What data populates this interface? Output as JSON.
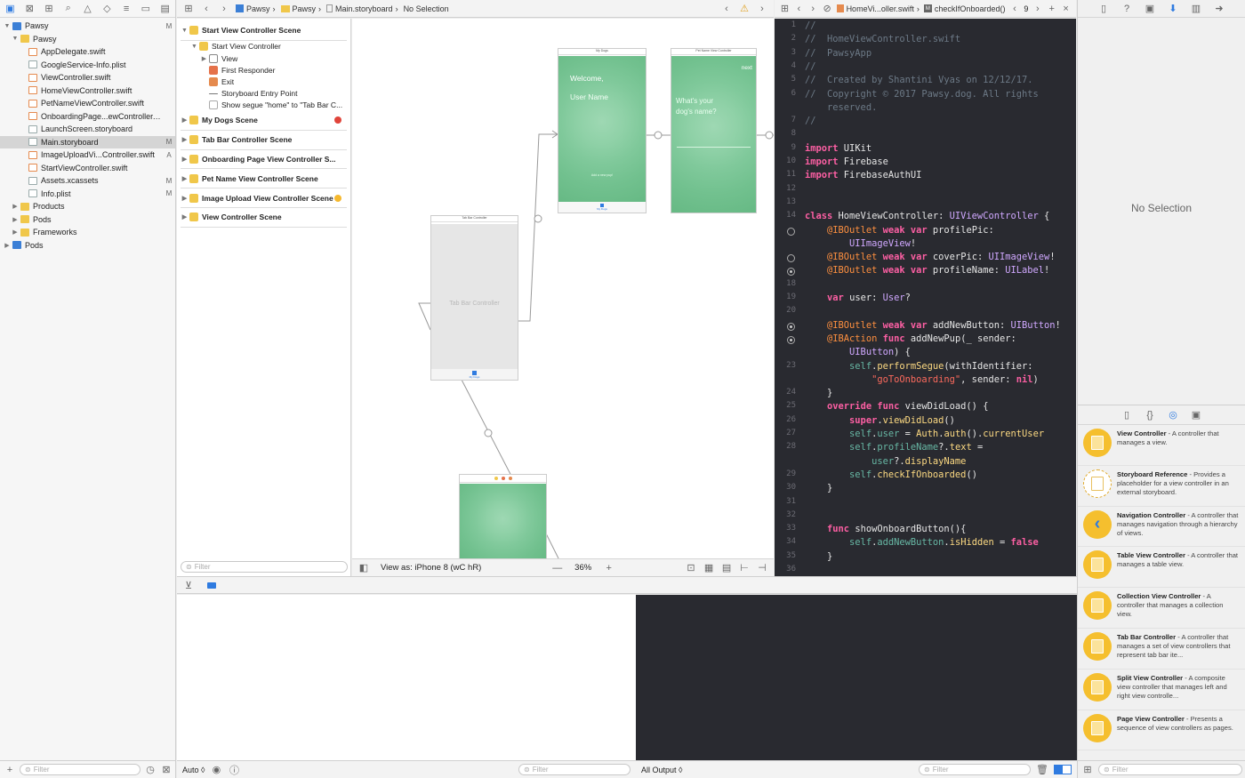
{
  "navigator": {
    "items": [
      {
        "label": "Pawsy",
        "badge": "M",
        "indent": 0,
        "disc": "▼",
        "icon": "f-proj"
      },
      {
        "label": "Pawsy",
        "badge": "",
        "indent": 1,
        "disc": "▼",
        "icon": "f-folder"
      },
      {
        "label": "AppDelegate.swift",
        "badge": "",
        "indent": 2,
        "disc": "",
        "icon": "f-swift"
      },
      {
        "label": "GoogleService-Info.plist",
        "badge": "",
        "indent": 2,
        "disc": "",
        "icon": "f-file"
      },
      {
        "label": "ViewController.swift",
        "badge": "",
        "indent": 2,
        "disc": "",
        "icon": "f-swift"
      },
      {
        "label": "HomeViewController.swift",
        "badge": "",
        "indent": 2,
        "disc": "",
        "icon": "f-swift"
      },
      {
        "label": "PetNameViewController.swift",
        "badge": "",
        "indent": 2,
        "disc": "",
        "icon": "f-swift"
      },
      {
        "label": "OnboardingPage...ewController.swift",
        "badge": "",
        "indent": 2,
        "disc": "",
        "icon": "f-swift"
      },
      {
        "label": "LaunchScreen.storyboard",
        "badge": "",
        "indent": 2,
        "disc": "",
        "icon": "f-file"
      },
      {
        "label": "Main.storyboard",
        "badge": "M",
        "indent": 2,
        "disc": "",
        "icon": "f-file",
        "selected": true
      },
      {
        "label": "ImageUploadVi...Controller.swift",
        "badge": "A",
        "indent": 2,
        "disc": "",
        "icon": "f-swift"
      },
      {
        "label": "StartViewController.swift",
        "badge": "",
        "indent": 2,
        "disc": "",
        "icon": "f-swift"
      },
      {
        "label": "Assets.xcassets",
        "badge": "M",
        "indent": 2,
        "disc": "",
        "icon": "f-file"
      },
      {
        "label": "Info.plist",
        "badge": "M",
        "indent": 2,
        "disc": "",
        "icon": "f-file"
      },
      {
        "label": "Products",
        "badge": "",
        "indent": 1,
        "disc": "▶",
        "icon": "f-folder"
      },
      {
        "label": "Pods",
        "badge": "",
        "indent": 1,
        "disc": "▶",
        "icon": "f-folder"
      },
      {
        "label": "Frameworks",
        "badge": "",
        "indent": 1,
        "disc": "▶",
        "icon": "f-folder"
      },
      {
        "label": "Pods",
        "badge": "",
        "indent": 0,
        "disc": "▶",
        "icon": "f-proj"
      }
    ],
    "filter_placeholder": "Filter"
  },
  "jumpbar": {
    "crumbs": [
      "Pawsy",
      "Pawsy",
      "Main.storyboard",
      "No Selection"
    ]
  },
  "outline": {
    "rows": [
      {
        "label": "Start View Controller Scene",
        "type": "scene",
        "indent": 0,
        "disc": "▼",
        "icon": "sico-scene"
      },
      {
        "label": "Start View Controller",
        "type": "item",
        "indent": 1,
        "disc": "▼",
        "icon": "sico-vc"
      },
      {
        "label": "View",
        "type": "item",
        "indent": 2,
        "disc": "▶",
        "icon": "sico-view"
      },
      {
        "label": "First Responder",
        "type": "item",
        "indent": 2,
        "disc": "",
        "icon": "sico-fr"
      },
      {
        "label": "Exit",
        "type": "item",
        "indent": 2,
        "disc": "",
        "icon": "sico-exit"
      },
      {
        "label": "Storyboard Entry Point",
        "type": "item",
        "indent": 2,
        "disc": "",
        "icon": "sico-arrow"
      },
      {
        "label": "Show segue \"home\" to \"Tab Bar C...",
        "type": "item",
        "indent": 2,
        "disc": "",
        "icon": "sico-segue"
      },
      {
        "label": "My Dogs Scene",
        "type": "scene",
        "indent": 0,
        "disc": "▶",
        "icon": "sico-scene",
        "status": "#e0443a"
      },
      {
        "label": "Tab Bar Controller Scene",
        "type": "scene",
        "indent": 0,
        "disc": "▶",
        "icon": "sico-scene"
      },
      {
        "label": "Onboarding Page View Controller S...",
        "type": "scene",
        "indent": 0,
        "disc": "▶",
        "icon": "sico-scene"
      },
      {
        "label": "Pet Name View Controller Scene",
        "type": "scene",
        "indent": 0,
        "disc": "▶",
        "icon": "sico-scene"
      },
      {
        "label": "Image Upload View Controller Scene",
        "type": "scene",
        "indent": 0,
        "disc": "▶",
        "icon": "sico-scene",
        "status": "#f5b82e"
      },
      {
        "label": "View Controller Scene",
        "type": "scene",
        "indent": 0,
        "disc": "▶",
        "icon": "sico-scene"
      }
    ],
    "filter_placeholder": "Filter"
  },
  "canvas": {
    "my_dogs": {
      "title": "My Dogs",
      "welcome": "Welcome,",
      "user": "User Name",
      "add": "Add a new pup!",
      "tab": "My Dogs"
    },
    "pet_name": {
      "title": "Pet Name View Controller",
      "next": "next",
      "question": "What's your dog's name?"
    },
    "tab_bar": {
      "title": "Tab Bar Controller",
      "label": "Tab Bar Controller",
      "tab": "My Dogs"
    },
    "footer": {
      "view_as": "View as: iPhone 8 (wC hR)",
      "zoom": "36%"
    }
  },
  "code_header": {
    "file": "HomeVi...oller.swift",
    "symbol": "checkIfOnboarded()",
    "count": "9"
  },
  "code": [
    {
      "n": "1",
      "h": "<span class=\"cm\">//</span>"
    },
    {
      "n": "2",
      "h": "<span class=\"cm\">//  HomeViewController.swift</span>"
    },
    {
      "n": "3",
      "h": "<span class=\"cm\">//  PawsyApp</span>"
    },
    {
      "n": "4",
      "h": "<span class=\"cm\">//</span>"
    },
    {
      "n": "5",
      "h": "<span class=\"cm\">//  Created by Shantini Vyas on 12/12/17.</span>"
    },
    {
      "n": "6",
      "h": "<span class=\"cm\">//  Copyright © 2017 Pawsy.dog. All rights</span>"
    },
    {
      "n": "",
      "h": "<span class=\"cm\">    reserved.</span>"
    },
    {
      "n": "7",
      "h": "<span class=\"cm\">//</span>"
    },
    {
      "n": "8",
      "h": ""
    },
    {
      "n": "9",
      "h": "<span class=\"kw\">import</span> UIKit"
    },
    {
      "n": "10",
      "h": "<span class=\"kw\">import</span> Firebase"
    },
    {
      "n": "11",
      "h": "<span class=\"kw\">import</span> FirebaseAuthUI"
    },
    {
      "n": "12",
      "h": ""
    },
    {
      "n": "13",
      "h": ""
    },
    {
      "n": "14",
      "h": "<span class=\"kw\">class</span> HomeViewController: <span class=\"ty\">UIViewController</span> {"
    },
    {
      "n": "",
      "g": "o",
      "h": "    <span class=\"at\">@IBOutlet</span> <span class=\"kw\">weak var</span> profilePic:"
    },
    {
      "n": "",
      "h": "        <span class=\"ty\">UIImageView</span>!"
    },
    {
      "n": "",
      "g": "o",
      "h": "    <span class=\"at\">@IBOutlet</span> <span class=\"kw\">weak var</span> coverPic: <span class=\"ty\">UIImageView</span>!"
    },
    {
      "n": "",
      "g": "f",
      "h": "    <span class=\"at\">@IBOutlet</span> <span class=\"kw\">weak var</span> profileName: <span class=\"ty\">UILabel</span>!"
    },
    {
      "n": "18",
      "h": ""
    },
    {
      "n": "19",
      "h": "    <span class=\"kw\">var</span> user: <span class=\"ty\">User</span>?"
    },
    {
      "n": "20",
      "h": ""
    },
    {
      "n": "",
      "g": "f",
      "h": "    <span class=\"at\">@IBOutlet</span> <span class=\"kw\">weak var</span> addNewButton: <span class=\"ty\">UIButton</span>!"
    },
    {
      "n": "",
      "g": "f",
      "h": "    <span class=\"at\">@IBAction</span> <span class=\"kw\">func</span> addNewPup(_ sender:"
    },
    {
      "n": "",
      "h": "        <span class=\"ty\">UIButton</span>) {"
    },
    {
      "n": "23",
      "h": "        <span class=\"fn\">self</span>.<span class=\"yl\">performSegue</span>(withIdentifier:"
    },
    {
      "n": "",
      "h": "            <span class=\"st\">\"goToOnboarding\"</span>, sender: <span class=\"nil\">nil</span>)"
    },
    {
      "n": "24",
      "h": "    }"
    },
    {
      "n": "25",
      "h": "    <span class=\"kw\">override func</span> viewDidLoad() {"
    },
    {
      "n": "26",
      "h": "        <span class=\"kw\">super</span>.<span class=\"yl\">viewDidLoad</span>()"
    },
    {
      "n": "27",
      "h": "        <span class=\"fn\">self</span>.<span class=\"fn\">user</span> = <span class=\"yl\">Auth</span>.<span class=\"yl\">auth</span>().<span class=\"yl\">currentUser</span>"
    },
    {
      "n": "28",
      "h": "        <span class=\"fn\">self</span>.<span class=\"fn\">profileName</span>?.<span class=\"yl\">text</span> ="
    },
    {
      "n": "",
      "h": "            <span class=\"fn\">user</span>?.<span class=\"yl\">displayName</span>"
    },
    {
      "n": "29",
      "h": "        <span class=\"fn\">self</span>.<span class=\"yl\">checkIfOnboarded</span>()"
    },
    {
      "n": "30",
      "h": "    }"
    },
    {
      "n": "31",
      "h": ""
    },
    {
      "n": "32",
      "h": ""
    },
    {
      "n": "33",
      "h": "    <span class=\"kw\">func</span> showOnboardButton(){"
    },
    {
      "n": "34",
      "h": "        <span class=\"fn\">self</span>.<span class=\"fn\">addNewButton</span>.<span class=\"yl\">isHidden</span> = <span class=\"kw\">false</span>"
    },
    {
      "n": "35",
      "h": "    }"
    },
    {
      "n": "36",
      "h": ""
    }
  ],
  "debug": {
    "auto_label": "Auto ◊",
    "var_filter": "Filter",
    "output_label": "All Output ◊",
    "console_filter": "Filter"
  },
  "inspector": {
    "no_selection": "No Selection"
  },
  "library": {
    "items": [
      {
        "title": "View Controller",
        "desc": " - A controller that manages a view.",
        "style": ""
      },
      {
        "title": "Storyboard Reference",
        "desc": " - Provides a placeholder for a view controller in an external storyboard.",
        "style": "dashed"
      },
      {
        "title": "Navigation Controller",
        "desc": " - A controller that manages navigation through a hierarchy of views.",
        "style": "nav"
      },
      {
        "title": "Table View Controller",
        "desc": " - A controller that manages a table view.",
        "style": ""
      },
      {
        "title": "Collection View Controller",
        "desc": " - A controller that manages a collection view.",
        "style": ""
      },
      {
        "title": "Tab Bar Controller",
        "desc": " - A controller that manages a set of view controllers that represent tab bar ite...",
        "style": ""
      },
      {
        "title": "Split View Controller",
        "desc": " - A composite view controller that manages left and right view controlle...",
        "style": ""
      },
      {
        "title": "Page View Controller",
        "desc": " - Presents a sequence of view controllers as pages.",
        "style": ""
      }
    ],
    "filter_placeholder": "Filter"
  }
}
